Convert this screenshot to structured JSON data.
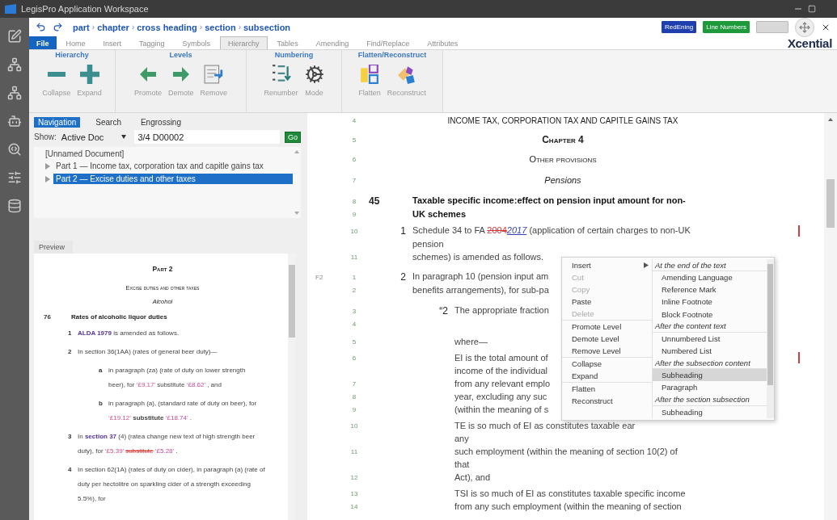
{
  "window": {
    "title": "LegisPro Application Workspace"
  },
  "breadcrumb": {
    "items": [
      "part",
      "chapter",
      "cross heading",
      "section",
      "subsection"
    ],
    "separator": "›"
  },
  "toggles": [
    {
      "label": "RedEning",
      "color": "#1f3fae",
      "on": true
    },
    {
      "label": "Line Numbers",
      "color": "#1e9a3a",
      "on": true
    },
    {
      "on": false
    }
  ],
  "menu_tabs": [
    {
      "label": "File",
      "kind": "file",
      "selected": false
    },
    {
      "label": "Home",
      "kind": "tab",
      "selected": false
    },
    {
      "label": "Insert",
      "kind": "tab",
      "selected": false
    },
    {
      "label": "Tagging",
      "kind": "tab",
      "selected": false
    },
    {
      "label": "Symbols",
      "kind": "tab",
      "selected": false
    },
    {
      "label": "Hierarchy",
      "kind": "tab",
      "selected": true
    },
    {
      "label": "Tables",
      "kind": "tab",
      "selected": false
    },
    {
      "label": "Amending",
      "kind": "tab",
      "selected": false
    },
    {
      "label": "Find/Replace",
      "kind": "tab",
      "selected": false
    },
    {
      "label": "Attributes",
      "kind": "tab",
      "selected": false
    }
  ],
  "logo": "Xcential",
  "ribbon": [
    {
      "title": "Hierarchy",
      "buttons": [
        {
          "label": "Collapse"
        },
        {
          "label": "Expand"
        }
      ]
    },
    {
      "title": "Levels",
      "buttons": [
        {
          "label": "Promote"
        },
        {
          "label": "Demote"
        },
        {
          "label": "Remove"
        }
      ]
    },
    {
      "title": "Numbering",
      "buttons": [
        {
          "label": "Renumber"
        },
        {
          "label": "Mode"
        }
      ]
    },
    {
      "title": "Flatten/Reconstruct",
      "buttons": [
        {
          "label": "Flatten"
        },
        {
          "label": "Reconstruct"
        }
      ]
    }
  ],
  "navigation": {
    "tabs": [
      {
        "label": "Navigation",
        "selected": true
      },
      {
        "label": "Search",
        "selected": false
      },
      {
        "label": "Engrossing",
        "selected": false
      }
    ],
    "show_label": "Show:",
    "show_value": "Active Doc",
    "doc_number": "3/4 D00002",
    "go": "Go",
    "tree": {
      "label": "[Unnamed Document]",
      "children": [
        {
          "label": "Part 1 — Income tax, corporation tax and capitle gains tax",
          "expanded": false,
          "selected": false
        },
        {
          "label": "Part 2 — Excise duties and other taxes",
          "expanded": false,
          "selected": true
        }
      ]
    }
  },
  "preview": {
    "tab": "Preview",
    "lines": [
      {
        "kind": "part",
        "text": "Part 2"
      },
      {
        "kind": "title",
        "text": "Excise duties and other taxes"
      },
      {
        "kind": "italic",
        "text": "Alcohol"
      },
      {
        "kind": "section",
        "label": "76",
        "text": "Rates of alcoholic liquor duties"
      },
      {
        "kind": "item",
        "label": "1",
        "text": [
          {
            "t": "ALDA 1979",
            "kind": "ref"
          },
          {
            "t": " is amended as follows."
          }
        ]
      },
      {
        "kind": "item",
        "label": "2",
        "text": "In section 36(1AA) (rates of general beer duty)—"
      },
      {
        "kind": "sub",
        "label": "a",
        "text": [
          {
            "t": "in paragraph (za) (rate of duty on lower strength beer), for "
          },
          {
            "t": "‘£9.17’",
            "kind": "old"
          },
          {
            "t": " substitute "
          },
          {
            "t": "‘£8.62’",
            "kind": "new"
          },
          {
            "t": " , and"
          }
        ]
      },
      {
        "kind": "sub",
        "label": "b",
        "text": [
          {
            "t": "in paragraph (a), (standard rate of duty on beer), for "
          },
          {
            "t": "‘£19.12’",
            "kind": "old"
          },
          {
            "t": " substitute ",
            "kind": "bold"
          },
          {
            "t": "‘£18.74’",
            "kind": "new"
          },
          {
            "t": " ."
          }
        ]
      },
      {
        "kind": "item",
        "label": "3",
        "text": [
          {
            "t": "In "
          },
          {
            "t": "section 37",
            "kind": "ref"
          },
          {
            "t": " (4) (ratea change new text of high strength beer duty), for "
          },
          {
            "t": "‘£5.39’ ",
            "kind": "old"
          },
          {
            "t": "substitute",
            "kind": "del"
          },
          {
            "t": " ‘£5.28’",
            "kind": "new"
          },
          {
            "t": " ."
          }
        ]
      },
      {
        "kind": "item",
        "label": "4",
        "text": "In section 62(1A) (rates of duty on cider), in paragraph (a) (rate of duty per hectolitre on sparkling cider of a strength exceeding 5.5%), for"
      }
    ]
  },
  "document": {
    "rows": [
      {
        "kind": "caps",
        "num": "4",
        "text": "INCOME TAX, CORPORATION TAX AND CAPITLE GAINS TAX"
      },
      {
        "kind": "chapter",
        "num": "5",
        "text": "Chapter 4"
      },
      {
        "kind": "smallcaps",
        "num": "6",
        "text": "Other provisions"
      },
      {
        "kind": "italic",
        "num": "7",
        "text": "Pensions"
      },
      {
        "kind": "section",
        "num": "8",
        "label": "45",
        "text": "Taxable specific income:effect on pension input amount for non-"
      },
      {
        "kind": "section-cont",
        "num": "9",
        "text": "UK schemes"
      },
      {
        "kind": "para",
        "num": "10",
        "label": "1",
        "changed": true,
        "text": [
          {
            "t": "Schedule 34 to FA "
          },
          {
            "t": "2004",
            "kind": "del"
          },
          {
            "t": "2017",
            "kind": "ins"
          },
          {
            "t": " (application of certain charges to non-UK"
          }
        ]
      },
      {
        "kind": "cont",
        "text": "pension"
      },
      {
        "kind": "cont",
        "num": "11",
        "text": "schemes) is amended as follows."
      },
      {
        "kind": "para-start",
        "marker": "F2",
        "num": "1",
        "label": "2",
        "text": "In paragraph 10 (pension input am"
      },
      {
        "kind": "cont",
        "num": "2",
        "text": "benefits arrangements), for sub-pa"
      },
      {
        "kind": "quote",
        "num": "3",
        "label": "“2",
        "text": "The appropriate fraction"
      },
      {
        "kind": "blank",
        "num": "4"
      },
      {
        "kind": "where",
        "num": "5",
        "text": "where—"
      },
      {
        "kind": "def",
        "num": "6",
        "changed": true,
        "text": "EI is the total amount of"
      },
      {
        "kind": "def-cont",
        "text": "income of the individual"
      },
      {
        "kind": "def-cont",
        "num": "7",
        "text": "from any relevant emplo"
      },
      {
        "kind": "def-cont",
        "num": "8",
        "text": "year, excluding any suc"
      },
      {
        "kind": "def-cont",
        "num": "9",
        "text": "(within the meaning of s"
      },
      {
        "kind": "def",
        "num": "10",
        "text": "TE is so much of EI as constitutes taxable ear"
      },
      {
        "kind": "def-cont",
        "text": "any"
      },
      {
        "kind": "def-cont",
        "num": "11",
        "text": "such employment (within the meaning of section 10(2) of"
      },
      {
        "kind": "def-cont",
        "text": "that"
      },
      {
        "kind": "def-cont",
        "num": "12",
        "text": "Act), and"
      },
      {
        "kind": "def",
        "num": "13",
        "text": "TSI is so much of EI as constitutes taxable specific income"
      },
      {
        "kind": "def-cont",
        "num": "14",
        "text": "from any such employment (within the meaning of section"
      }
    ]
  },
  "context_menu": {
    "groups": [
      [
        {
          "label": "Insert",
          "disabled": false,
          "submenu": true
        },
        {
          "label": "Cut",
          "disabled": true
        },
        {
          "label": "Copy",
          "disabled": true
        },
        {
          "label": "Paste",
          "disabled": false
        },
        {
          "label": "Delete",
          "disabled": true
        }
      ],
      [
        {
          "label": "Promote Level",
          "disabled": false
        },
        {
          "label": "Demote Level",
          "disabled": false
        },
        {
          "label": "Remove Level",
          "disabled": false
        }
      ],
      [
        {
          "label": "Collapse",
          "disabled": false
        },
        {
          "label": "Expand",
          "disabled": false
        }
      ],
      [
        {
          "label": "Flatten",
          "disabled": false
        },
        {
          "label": "Reconstruct",
          "disabled": false
        }
      ]
    ],
    "submenu": [
      {
        "kind": "header",
        "label": "At the end of the text"
      },
      {
        "kind": "item",
        "label": "Amending Language",
        "selected": false
      },
      {
        "kind": "item",
        "label": "Reference Mark",
        "selected": false
      },
      {
        "kind": "item",
        "label": "Inline Footnote",
        "selected": false
      },
      {
        "kind": "item",
        "label": "Block Footnote",
        "selected": false
      },
      {
        "kind": "header",
        "label": "After the content text"
      },
      {
        "kind": "item",
        "label": "Unnumbered List",
        "selected": false
      },
      {
        "kind": "item",
        "label": "Numbered List",
        "selected": false
      },
      {
        "kind": "header",
        "label": "After the subsection content"
      },
      {
        "kind": "item",
        "label": "Subheading",
        "selected": true
      },
      {
        "kind": "item",
        "label": "Paragraph",
        "selected": false
      },
      {
        "kind": "header",
        "label": "After the section subsection"
      },
      {
        "kind": "item",
        "label": "Subheading",
        "selected": false
      }
    ]
  }
}
